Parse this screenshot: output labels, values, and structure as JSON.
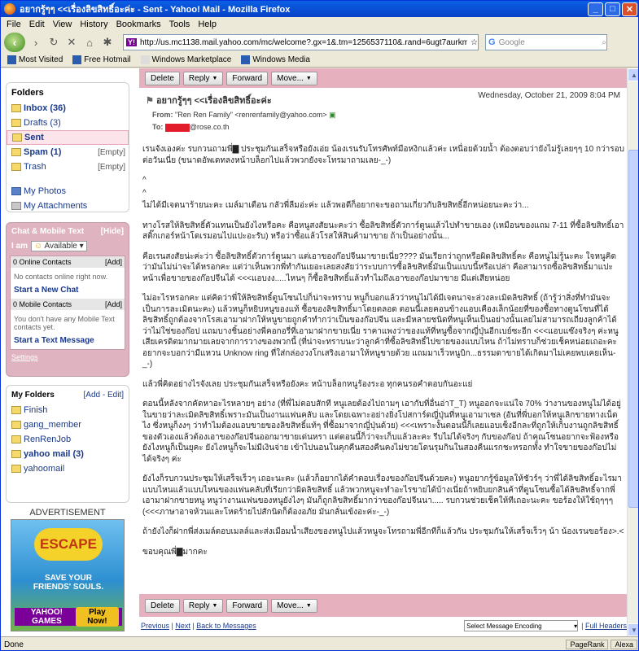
{
  "window": {
    "title": "อยากรู้ๆๆ <<เรื่องลิขสิทธิ์อะค่ะ - Sent - Yahoo! Mail - Mozilla Firefox"
  },
  "menu": [
    "File",
    "Edit",
    "View",
    "History",
    "Bookmarks",
    "Tools",
    "Help"
  ],
  "url": "http://us.mc1138.mail.yahoo.com/mc/welcome?.gx=1&.tm=1256537110&.rand=6ugt7aurkmjkk#_pg=s",
  "search_placeholder": "Google",
  "bookmarks": [
    "Most Visited",
    "Free Hotmail",
    "Windows Marketplace",
    "Windows Media"
  ],
  "sidebar": {
    "folders_title": "Folders",
    "folders": [
      {
        "name": "Inbox (36)",
        "extra": ""
      },
      {
        "name": "Drafts (3)",
        "extra": ""
      },
      {
        "name": "Sent",
        "extra": ""
      },
      {
        "name": "Spam (1)",
        "extra": "[Empty]"
      },
      {
        "name": "Trash",
        "extra": "[Empty]"
      }
    ],
    "my_photos": "My Photos",
    "my_attachments": "My Attachments",
    "chat_title": "Chat & Mobile Text",
    "hide": "[Hide]",
    "i_am": "I am",
    "status": "Available",
    "online_contacts": "0 Online Contacts",
    "add": "[Add]",
    "no_contacts": "No contacts online right now.",
    "start_chat": "Start a New Chat",
    "mobile_contacts": "0 Mobile Contacts",
    "no_mobile": "You don't have any Mobile Text contacts yet.",
    "start_text": "Start a Text Message",
    "settings": "Settings",
    "my_folders_title": "My Folders",
    "add_edit": "[Add - Edit]",
    "my_folders": [
      "Finish",
      "gang_member",
      "RenRenJob",
      "yahoo mail (3)",
      "yahoomail"
    ],
    "ad_label": "ADVERTISEMENT",
    "ad_escape": "ESCAPE",
    "ad_tag": "SAVE YOUR FRIENDS' SOULS.",
    "ad_yahoo": "YAHOO! GAMES",
    "ad_play": "Play Now!"
  },
  "toolbar": {
    "delete": "Delete",
    "reply": "Reply",
    "forward": "Forward",
    "move": "Move..."
  },
  "message": {
    "subject": "อยากรู้ๆๆ <<เรื่องลิขสิทธิ์อะค่ะ",
    "date": "Wednesday, October 21, 2009 8:04 PM",
    "from_label": "From:",
    "from": "\"Ren Ren Family\" <renrenfamily@yahoo.com>",
    "to_label": "To:",
    "to_domain": "@rose.co.th",
    "paragraphs": [
      "เรนจังเองค่ะ รบกวนถามพี่▇ ประชุมกันเสร็จหรือยังเอ่ย น้องเรนรับโทรศัพท์มือหงิกแล้วค่ะ เหนื่อยด้วยน้ำ ต้องตอบว่ายังไม่รู้เลยๆๆ 10 กว่ารอบต่อวันเนี่ย (ขนาดอัพเดทลงหน้าบล็อกไปแล้วพวกยังจะโทรมาถามเลย-_-)",
      "^",
      "^",
      "ไม่ได้มีเจตนาร้ายนะคะ เมล์มาเตือน กลัวพี่ลืมอ่ะค่ะ แล้วพอดีก็อยากจะขอถามเกี่ยวกับลิขสิทธิ์อีกหน่อยนะคะว่า...",
      "ทางโรสให้ลิขสิทธิ์ตัวแทนเป็นยังไงหรือคะ คือหนูสงสัยนะคะว่า ซื้อลิขสิทธิ์ตัวการ์ตูนแล้วไปทำขายเอง (เหมือนของแถม 7-11 ที่ซื้อลิขสิทธิ์เอาสติ๊กเกอร์หน้าโดเรมอนไปแปะอะรับ) หรือว่าซื้อแล้วโรสให้สินค้ามาขาย ถ้าเป็นอย่างนั้น...",
      "คือเรนสงสัยน่ะค่ะว่า ซื้อลิขสิทธิ์ตัวการ์ตูนมา แต่เอาของก๊อปจีนมาขายเนี่ย???? มันเรียกว่าถูกหรือผิดลิขสิทธิ์คะ คือหนูไม่รู้นะคะ ใจหนูคิดว่ามันไม่น่าจะได้หรอกคะ แต่ว่าเห็นพวกพี่ทำกันเยอะเลยสงสัยว่าระบบการซื้อลิขสิทธิ์มันเป็นแบบนี้หรือเปล่า คือสามารถซื้อลิขสิทธิ์มาแปะหน้าเพื่อขายของก๊อปจีนได้ <<<แอบงง.....ไหนๆ ก็ซื้อลิขสิทธิ์แล้วทำไมถึงเอาของก๊อปมาขาย มีแต่เสียหน่อย",
      "ไม่อะไรหรอกคะ แต่คิดว่าพี่ให้ลิขสิทธิ์ตูนโซนไปก็น่าจะทราบ หนูก็บอกแล้วว่าหนูไม่ได้มีเจตนาจะล่วงละเมิดลิขสิทธิ์ (ถ้ารู้ว่าสิ่งที่ทำมันจะเป็นการละเมิดนะคะ) แล้วหนูก็หยิบหนูของแท้ ซื้อของลิขสิทธิ์มาโดยตลอด ตอนนี้เลยคอนข้างแอบเคืองเล็กน้อยที่ของซื้อทางตูนโซนที่ได้ลิขสิทธิ์ถูกต้องจากโรสเอามาฝากให้หนูขายถูกคำทำกว่าเป็นของก๊อปจีน และมีหลายชนิดที่หนูเห็นเป็นอย่างนั้นเลยไม่สามารถเถียงลูกค้าได้ว่าไม่ใช่ของก๊อป แถมบางชิ้นอย่างพี่คอกอรี่ที่เอามาฝากขายเนี่ย ราคาแพงว่าของแท้ที่หนูซื้อจากญี่ปุ่นอีกเบย์ซะอีก <<<แอบแซ๊งจริงๆ ค่ะหนูเสียเครดิตมากมายเลยจากการวางของพวกนี้ (ที่น่าจะทราบนะว่าลูกค้าที่ซื้อลิขสิทธิ์ไปขายของแบบไหน ถ้าไม่ทราบก็ช่วยเช็คหน่อยเถอะคะ อยากจะบอกว่ามีแหวน Unknow ring ที่ใส่กล่องวงโกเสริงเอามาให้หนูขายด้วย แถมมาเร็วหนูบิก...ธรรมดาขายได้เกิดมาไม่เคยพบเคยเห็น-_-)",
      "แล้วพี่คิดอย่างไรจังเลย ประชุมกันเสร็จหรือยังคะ หน้าบล็อกหนูร้องระอ ทุกคนรอคำตอบกันอะแย่",
      "ตอนนี้หลังจากคัดหาอะไรหลายๆ อย่าง (ที่พี่ไม่ตอบสักที หนูเลยต้องไปถามๆ เอากับที่อื่นอ่าT_T) หนูออกจะแน่ใจ 70% ว่างานของหนูไม่ได้อยู่ในขายว่าละเมิดลิขสิทธิ์เพราะมันเป็นงานแฟนคลับ และโดยเฉพาะอย่างยิ่งโปสการ์ดญี่ปุ่นที่หนูเอามาเซล (อันที่พี่บอกให้หนูเลิกขายทางเน็ตไง ซึ่งหนูก็งงๆ ว่าทำไมต้องแอบขายของลิขสิทธิ์แท้ๆ ที่ซื้อมาจากญี่ปุ่นด้วย) <<<เพราะงั้นตอนนี้ก็เลยแอบเซ็งอีกละที่ถูกให้เก็บงานถูกลิขสิทธิ์ของตัวเองแล้วต้องเอาของก๊อปจีนออกมาขายเด่นหรา แต่ตอนนี้ก็ว่าจะเก็บแล้วละคะ รีบไม่ได้จริงๆ กับของก๊อป ถ้าคุณโซนอยากจะฟ้องหรือยังไงหนูก็เป็นยุคะ ยังไงหนูก็จะไม่มีเงินจ่าย เข้าไปนอนในคุกคืนสองคืนคงไม่ขวยโดนรุมกินในสองคืนแรกชะหรอกทั้ง ทำใจขายของก๊อปไม่ได้จริงๆ ค่ะ",
      "ยังไงก็รบกวนประชุมให้เสร็จเร็วๆ เถอะนะคะ (แล้วก็อยากได้คำตอบเรื่องของก๊อปจีนด้วยคะ) หนูอยากรู้ข้อมูลให้ชัวร์ๆ ว่าพี่ได้ลิขสิทธิ์อะไรมาแบบไหนแล้วแบบไหนของแฟนคลับที่เรียกว่าผิดลิขสิทธิ์ แล้วพวกหนูจะทำอะไรขายได้บ้างเนี่ยถ้าหยิบยกสินค้าที่ตูนโซนซื้อได้ลิขสิทธิ์จากพี่เอามาฝากขายหนู หนูว่างานแฟนของหนูยังไงๆ มันก็ถูกลิขสิทธิ์มากว่าของก๊อปจีนนา..... รบกวนช่วยเช็คให้ทีเถอะนะคะ ขอร้องให้ใช้ฤๆๆๆ (<<<ภาษาอาจห้วนและโหดร้ายไปสักนิดก็ต้องอภัย มันกลั่นเข้งอะค่ะ-_-)",
      "ถ้ายังไงก็ฝากพี่ส่งเมล์ตอบเมลล์และส่งเมือมน้ำเสียงของหนูไปแล้วหนูจะโทรถามพี่อีกทีก็แล้วกัน ประชุมกันให้เสร็จเร็วๆ น้า น้องเรนขอร้อง>.<",
      "ขอบคุณพี่▇มากคะ"
    ]
  },
  "footer": {
    "previous": "Previous",
    "next": "Next",
    "back": "Back to Messages",
    "encoding": "Select Message Encoding",
    "full_headers": "Full Headers"
  },
  "status": {
    "text": "Done",
    "ext1": "PageRank",
    "ext2": "Alexa"
  }
}
